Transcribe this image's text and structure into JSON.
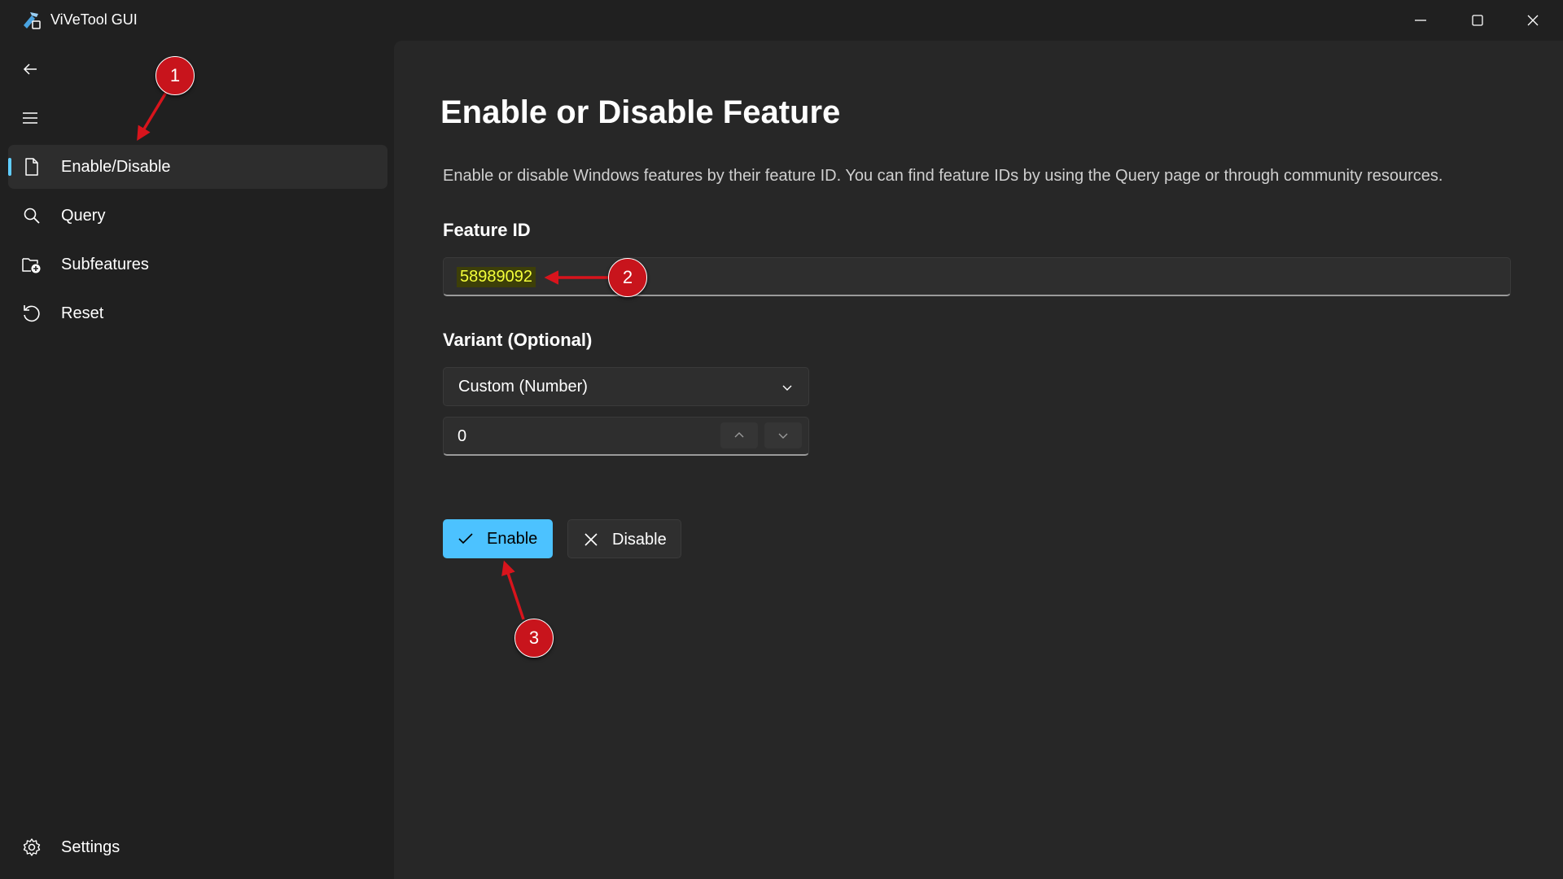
{
  "window": {
    "title": "ViVeTool GUI",
    "icon": "vivetool-app-icon",
    "controls": [
      "minimize-icon",
      "maximize-icon",
      "close-icon"
    ]
  },
  "sidebar": {
    "back_icon": "back-arrow-icon",
    "menu_icon": "hamburger-menu-icon",
    "items": [
      {
        "label": "Enable/Disable",
        "icon": "document-icon",
        "selected": true
      },
      {
        "label": "Query",
        "icon": "search-icon",
        "selected": false
      },
      {
        "label": "Subfeatures",
        "icon": "folder-add-icon",
        "selected": false
      },
      {
        "label": "Reset",
        "icon": "reset-icon",
        "selected": false
      }
    ],
    "footer": {
      "label": "Settings",
      "icon": "gear-icon"
    }
  },
  "main": {
    "title": "Enable or Disable Feature",
    "description": "Enable or disable Windows features by their feature ID. You can find feature IDs by using the Query page or through community resources.",
    "feature_id": {
      "label": "Feature ID",
      "value": "58989092"
    },
    "variant": {
      "label": "Variant (Optional)",
      "selected": "Custom (Number)",
      "number_value": "0"
    },
    "buttons": {
      "enable": "Enable",
      "disable": "Disable"
    }
  },
  "annotations": {
    "markers": [
      "1",
      "2",
      "3"
    ],
    "color": "#c8141c"
  },
  "colors": {
    "accent": "#4cc2ff",
    "selection_pill": "#60cdff",
    "highlight_text": "#f4ff3a",
    "background": "#202020",
    "content_background": "#272727"
  }
}
